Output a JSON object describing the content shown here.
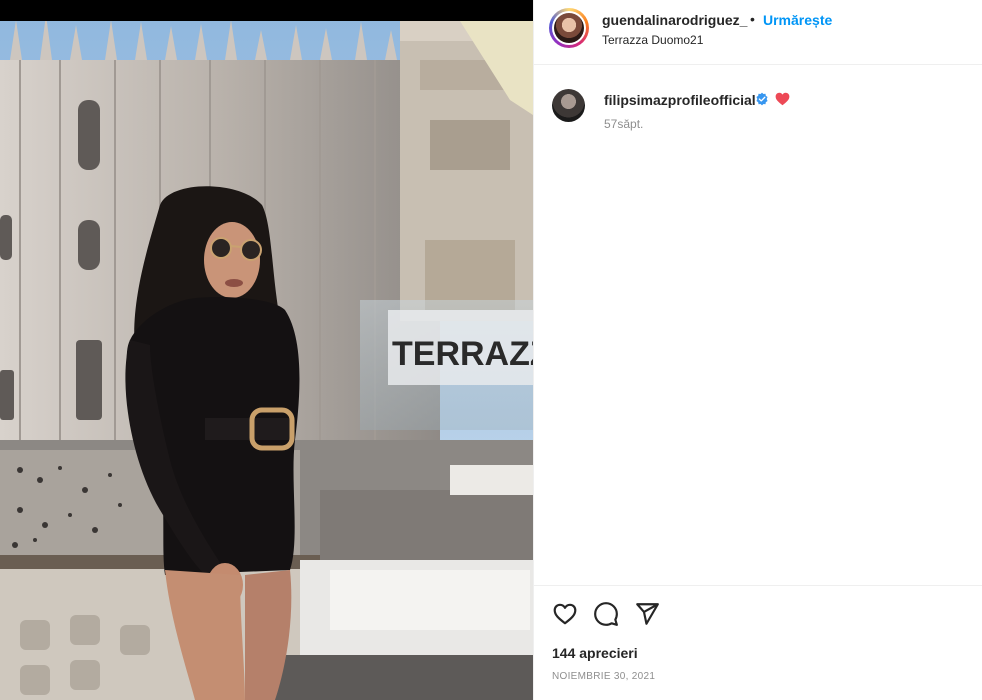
{
  "post": {
    "username": "guendalinarodriguez_",
    "separator": "•",
    "follow_label": "Urmărește",
    "location": "Terrazza Duomo21",
    "sign_text": "TERRAZZA DUOMO"
  },
  "comment": {
    "username": "filipsimazprofileofficial",
    "emoji": "heart-emoji",
    "time": "57săpt."
  },
  "footer": {
    "likes": "144 aprecieri",
    "date": "NOIEMBRIE 30, 2021"
  },
  "colors": {
    "accent": "#0095f6",
    "text": "#262626",
    "muted": "#8e8e8e",
    "verified": "#3897f0",
    "heart": "#ed4956"
  }
}
